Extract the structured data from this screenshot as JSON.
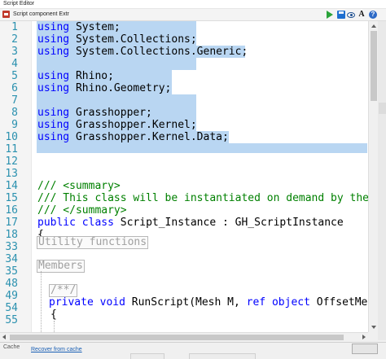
{
  "window": {
    "title": "Script Editor"
  },
  "toolbar": {
    "component_label": "Script component  Extr",
    "icons": [
      "component-icon",
      "run-icon",
      "save-icon",
      "preview-icon",
      "font-icon",
      "help-icon"
    ]
  },
  "editor": {
    "line_numbers": [
      "1",
      "2",
      "3",
      "4",
      "5",
      "6",
      "7",
      "8",
      "9",
      "10",
      "11",
      "12",
      "13",
      "14",
      "15",
      "16",
      "17",
      "18",
      "33",
      "34",
      "35",
      "48",
      "49",
      "54",
      "55"
    ],
    "lines": {
      "l1": "System;",
      "l2": "System.Collections;",
      "l3": "System.Collections.Generic;",
      "l5": "Rhino;",
      "l6": "Rhino.Geometry;",
      "l8": "Grasshopper;",
      "l9": "Grasshopper.Kernel;",
      "l10": "Grasshopper.Kernel.Data;",
      "kw_using": "using",
      "l14": "/// <summary>",
      "l15": "/// This class will be instantiated on demand by the",
      "l16": "/// </summary>",
      "l17_kw1": "public",
      "l17_kw2": "class",
      "l17_rest": " Script_Instance : GH_ScriptInstance",
      "l18": "{",
      "l33": "Utility functions",
      "l35": "Members",
      "l49": "/**/",
      "l54_kw1": "private",
      "l54_kw2": "void",
      "l54_mid": " RunScript(Mesh M, ",
      "l54_kw3": "ref",
      "l54_kw4": "object",
      "l54_end": " OffsetMes",
      "l55": "{"
    }
  },
  "status": {
    "cache_label": "Cache",
    "recover_link": "Recover from cache"
  },
  "colors": {
    "keyword": "#0000ff",
    "comment": "#008000",
    "line_number": "#2b91af",
    "selection": "#b9d6f2"
  }
}
